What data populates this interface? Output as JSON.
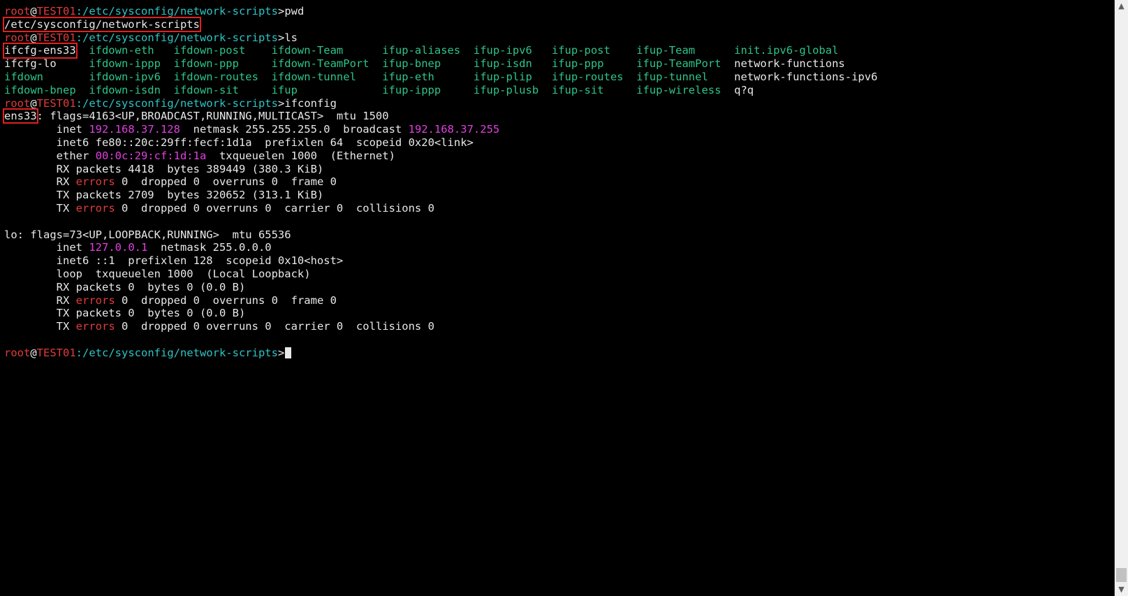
{
  "colors": {
    "background": "#000000",
    "text": "#e8e8e8",
    "user": "#e03c3c",
    "host": "#e03c3c",
    "path": "#2ec4c4",
    "ls_exec": "#2ec48a",
    "ip": "#e040e0",
    "error": "#e03c3c",
    "highlight_box": "#e02020"
  },
  "prompt": {
    "user": "root",
    "at": "@",
    "host": "TEST01",
    "sep": ":",
    "path": "/etc/sysconfig/network-scripts",
    "end": ">"
  },
  "commands": [
    "pwd",
    "ls",
    "ifconfig"
  ],
  "pwd_output": "/etc/sysconfig/network-scripts",
  "ls_output": {
    "rows": [
      [
        {
          "text": "ifcfg-ens33",
          "color": "plain",
          "boxed": true
        },
        {
          "text": "ifdown-eth",
          "color": "exec"
        },
        {
          "text": "ifdown-post",
          "color": "exec"
        },
        {
          "text": "ifdown-Team",
          "color": "exec"
        },
        {
          "text": "ifup-aliases",
          "color": "exec"
        },
        {
          "text": "ifup-ipv6",
          "color": "exec"
        },
        {
          "text": "ifup-post",
          "color": "exec"
        },
        {
          "text": "ifup-Team",
          "color": "exec"
        },
        {
          "text": "init.ipv6-global",
          "color": "exec"
        }
      ],
      [
        {
          "text": "ifcfg-lo",
          "color": "plain"
        },
        {
          "text": "ifdown-ippp",
          "color": "exec"
        },
        {
          "text": "ifdown-ppp",
          "color": "exec"
        },
        {
          "text": "ifdown-TeamPort",
          "color": "exec"
        },
        {
          "text": "ifup-bnep",
          "color": "exec"
        },
        {
          "text": "ifup-isdn",
          "color": "exec"
        },
        {
          "text": "ifup-ppp",
          "color": "exec"
        },
        {
          "text": "ifup-TeamPort",
          "color": "exec"
        },
        {
          "text": "network-functions",
          "color": "plain"
        }
      ],
      [
        {
          "text": "ifdown",
          "color": "exec"
        },
        {
          "text": "ifdown-ipv6",
          "color": "exec"
        },
        {
          "text": "ifdown-routes",
          "color": "exec"
        },
        {
          "text": "ifdown-tunnel",
          "color": "exec"
        },
        {
          "text": "ifup-eth",
          "color": "exec"
        },
        {
          "text": "ifup-plip",
          "color": "exec"
        },
        {
          "text": "ifup-routes",
          "color": "exec"
        },
        {
          "text": "ifup-tunnel",
          "color": "exec"
        },
        {
          "text": "network-functions-ipv6",
          "color": "plain"
        }
      ],
      [
        {
          "text": "ifdown-bnep",
          "color": "exec"
        },
        {
          "text": "ifdown-isdn",
          "color": "exec"
        },
        {
          "text": "ifdown-sit",
          "color": "exec"
        },
        {
          "text": "ifup",
          "color": "exec"
        },
        {
          "text": "ifup-ippp",
          "color": "exec"
        },
        {
          "text": "ifup-plusb",
          "color": "exec"
        },
        {
          "text": "ifup-sit",
          "color": "exec"
        },
        {
          "text": "ifup-wireless",
          "color": "exec"
        },
        {
          "text": "q?q",
          "color": "plain"
        }
      ]
    ]
  },
  "ifconfig_output": [
    [
      {
        "t": "ens33",
        "box": true
      },
      {
        "t": ": flags=4163<UP,BROADCAST,RUNNING,MULTICAST>  mtu 1500"
      }
    ],
    [
      {
        "t": "        inet "
      },
      {
        "t": "192.168.37.128",
        "c": "ip"
      },
      {
        "t": "  netmask 255.255.255.0  broadcast "
      },
      {
        "t": "192.168.37.255",
        "c": "ip"
      }
    ],
    [
      {
        "t": "        inet6 fe80::20c:29ff:fecf:1d1a  prefixlen 64  scopeid 0x20<link>"
      }
    ],
    [
      {
        "t": "        ether "
      },
      {
        "t": "00:0c:29:cf:1d:1a",
        "c": "ip"
      },
      {
        "t": "  txqueuelen 1000  (Ethernet)"
      }
    ],
    [
      {
        "t": "        RX packets 4418  bytes 389449 (380.3 KiB)"
      }
    ],
    [
      {
        "t": "        RX "
      },
      {
        "t": "errors",
        "c": "error"
      },
      {
        "t": " 0  dropped 0  overruns 0  frame 0"
      }
    ],
    [
      {
        "t": "        TX packets 2709  bytes 320652 (313.1 KiB)"
      }
    ],
    [
      {
        "t": "        TX "
      },
      {
        "t": "errors",
        "c": "error"
      },
      {
        "t": " 0  dropped 0 overruns 0  carrier 0  collisions 0"
      }
    ],
    [
      {
        "t": ""
      }
    ],
    [
      {
        "t": "lo: flags=73<UP,LOOPBACK,RUNNING>  mtu 65536"
      }
    ],
    [
      {
        "t": "        inet "
      },
      {
        "t": "127.0.0.1",
        "c": "ip"
      },
      {
        "t": "  netmask 255.0.0.0"
      }
    ],
    [
      {
        "t": "        inet6 ::1  prefixlen 128  scopeid 0x10<host>"
      }
    ],
    [
      {
        "t": "        loop  txqueuelen 1000  (Local Loopback)"
      }
    ],
    [
      {
        "t": "        RX packets 0  bytes 0 (0.0 B)"
      }
    ],
    [
      {
        "t": "        RX "
      },
      {
        "t": "errors",
        "c": "error"
      },
      {
        "t": " 0  dropped 0  overruns 0  frame 0"
      }
    ],
    [
      {
        "t": "        TX packets 0  bytes 0 (0.0 B)"
      }
    ],
    [
      {
        "t": "        TX "
      },
      {
        "t": "errors",
        "c": "error"
      },
      {
        "t": " 0  dropped 0 overruns 0  carrier 0  collisions 0"
      }
    ],
    [
      {
        "t": ""
      }
    ]
  ],
  "scrollbar": {
    "up_icon": "▲",
    "down_icon": "▼"
  }
}
